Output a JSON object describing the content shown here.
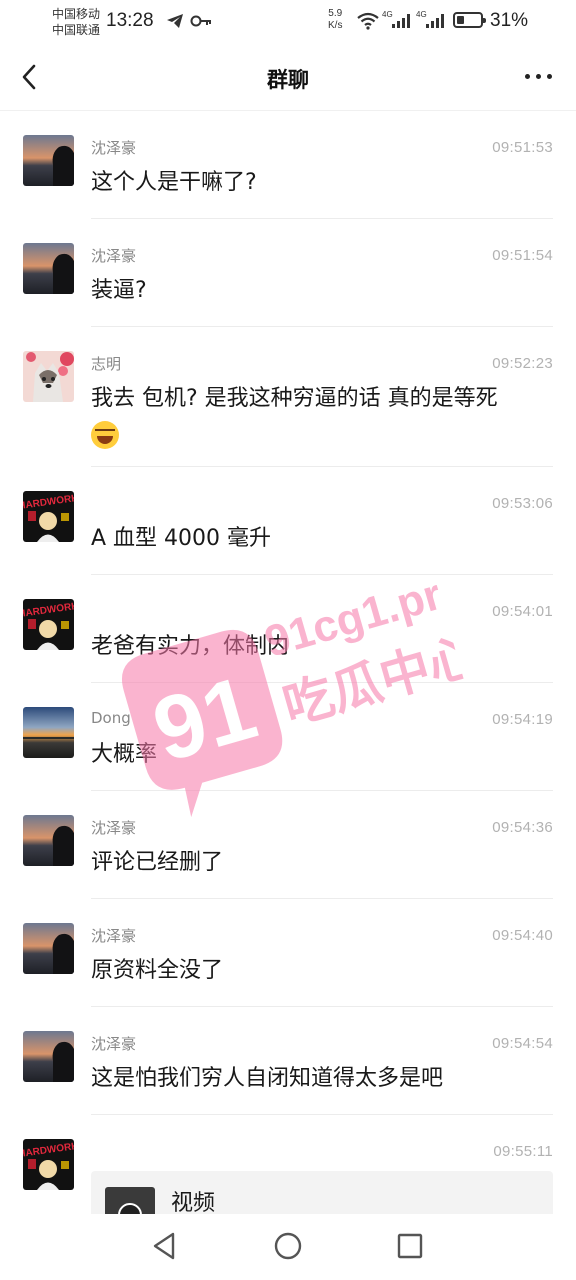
{
  "status_bar": {
    "carrier1": "中国移动",
    "carrier2": "中国联通",
    "time": "13:28",
    "net_speed_value": "5.9",
    "net_speed_unit": "K/s",
    "sig1_tag": "4G",
    "sig2_tag": "4G",
    "battery_percent": "31%",
    "battery_level": 0.31,
    "icons": [
      "telegram-icon",
      "key-icon",
      "wifi-icon",
      "signal-icon",
      "battery-icon"
    ]
  },
  "nav": {
    "title": "群聊",
    "back_icon": "chevron-left-icon",
    "more_icon": "more-dots-icon"
  },
  "messages": [
    {
      "sender": "沈泽豪",
      "time": "09:51:53",
      "text": "这个人是干嘛了?",
      "avatar": "sunset-silhouette"
    },
    {
      "sender": "沈泽豪",
      "time": "09:51:54",
      "text": "装逼?",
      "avatar": "sunset-silhouette"
    },
    {
      "sender": "志明",
      "time": "09:52:23",
      "text": "我去 包机? 是我这种穷逼的话 真的是等死",
      "emoji": "laugh-cry-emoji",
      "avatar": "husky-flowers"
    },
    {
      "sender": "",
      "time": "09:53:06",
      "text": "A 血型 4000 毫升",
      "avatar": "hardwork-poster"
    },
    {
      "sender": "",
      "time": "09:54:01",
      "text": "老爸有实力，体制内",
      "avatar": "hardwork-poster"
    },
    {
      "sender": "Dong",
      "time": "09:54:19",
      "text": "大概率",
      "avatar": "sunset-landscape"
    },
    {
      "sender": "沈泽豪",
      "time": "09:54:36",
      "text": "评论已经删了",
      "avatar": "sunset-silhouette"
    },
    {
      "sender": "沈泽豪",
      "time": "09:54:40",
      "text": "原资料全没了",
      "avatar": "sunset-silhouette"
    },
    {
      "sender": "沈泽豪",
      "time": "09:54:54",
      "text": "这是怕我们穷人自闭知道得太多是吧",
      "avatar": "sunset-silhouette"
    },
    {
      "sender": "",
      "time": "09:55:11",
      "video_label": "视频",
      "avatar": "hardwork-poster"
    }
  ],
  "avatar_text": "HARDWORK",
  "watermark": {
    "number": "91",
    "domain": "91cg1.pro",
    "slogan": "吃瓜中心",
    "color": "#f778a9"
  },
  "bottom_nav": [
    "back-triangle-icon",
    "home-circle-icon",
    "recents-square-icon"
  ]
}
